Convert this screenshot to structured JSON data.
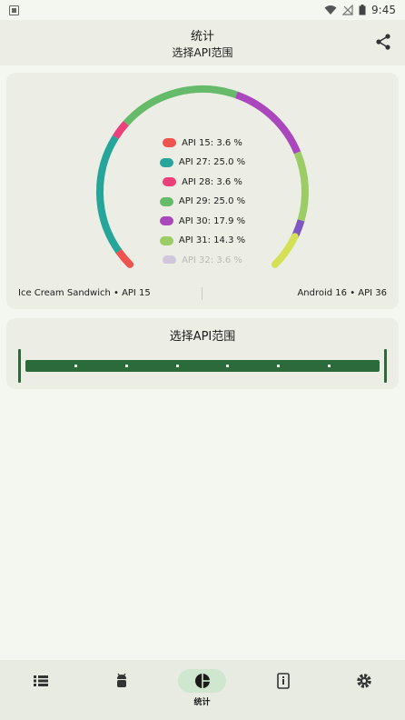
{
  "status_bar": {
    "time": "9:45"
  },
  "header": {
    "title": "统计",
    "subtitle": "选择API范围"
  },
  "chart_data": {
    "type": "pie",
    "style": "arc-gauge",
    "legend": [
      {
        "label": "API 15: 3.6 %",
        "value": 3.6,
        "color": "#ef5350"
      },
      {
        "label": "API 27: 25.0 %",
        "value": 25.0,
        "color": "#26a69a"
      },
      {
        "label": "API 28: 3.6 %",
        "value": 3.6,
        "color": "#ec407a"
      },
      {
        "label": "API 29: 25.0 %",
        "value": 25.0,
        "color": "#66bb6a"
      },
      {
        "label": "API 30: 17.9 %",
        "value": 17.9,
        "color": "#ab47bc"
      },
      {
        "label": "API 31: 14.3 %",
        "value": 14.3,
        "color": "#9ccc65"
      },
      {
        "label": "API 32: 3.6 %",
        "value": 3.6,
        "color": "#7e57c2"
      },
      {
        "label": "",
        "value": 7.1,
        "color": "#d4e157"
      }
    ]
  },
  "range": {
    "min_label": "Ice Cream Sandwich • API 15",
    "max_label": "Android 16 • API 36"
  },
  "range_card": {
    "title": "选择API范围"
  },
  "bottom_nav": {
    "items": [
      {
        "icon": "list-icon",
        "label": ""
      },
      {
        "icon": "android-icon",
        "label": ""
      },
      {
        "icon": "pie-chart-icon",
        "label": "统计",
        "active": true
      },
      {
        "icon": "device-info-icon",
        "label": ""
      },
      {
        "icon": "gear-icon",
        "label": ""
      }
    ]
  }
}
